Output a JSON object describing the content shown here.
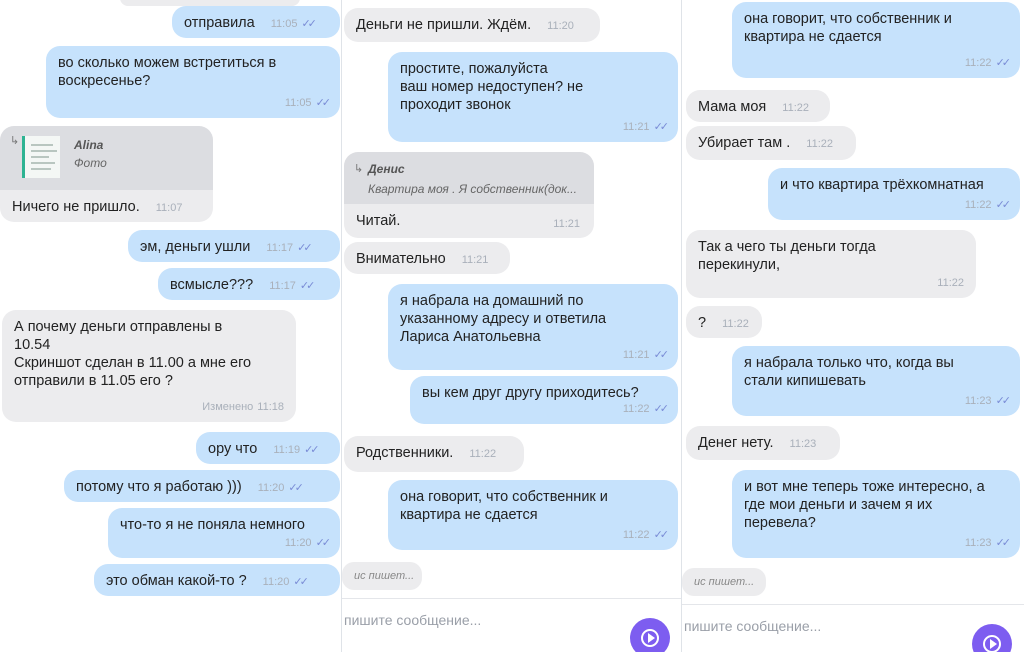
{
  "panel1": {
    "messages": [
      {
        "text": "отправила",
        "time": "11:05",
        "read": true
      },
      {
        "text": "во сколько можем встретиться в воскресенье?",
        "time": "11:05",
        "read": true
      },
      {
        "reply_name": "Alina",
        "reply_sub": "Фото",
        "text": "Ничего не пришло.",
        "time": "11:07"
      },
      {
        "text": "эм, деньги ушли",
        "time": "11:17",
        "read": true
      },
      {
        "text": "всмысле???",
        "time": "11:17",
        "read": true
      },
      {
        "text": "А почему деньги отправлены в\n10.54\nСкриншот сделан в 11.00 а мне его\nотправили в 11.05 его ?",
        "time": "11:18",
        "edited": "Изменено"
      },
      {
        "text": "ору что",
        "time": "11:19",
        "read": true
      },
      {
        "text": "потому что я работаю )))",
        "time": "11:20",
        "read": true
      },
      {
        "text": "что-то я не поняла немного",
        "time": "11:20",
        "read": true
      },
      {
        "text": "это обман какой-то ?",
        "time": "11:20",
        "read": true
      }
    ]
  },
  "panel2": {
    "messages": [
      {
        "text": "Деньги не пришли. Ждём.",
        "time": "11:20"
      },
      {
        "text": "простите, пожалуйста\nваш номер недоступен? не\nпроходит звонок",
        "time": "11:21",
        "read": true
      },
      {
        "reply_name": "Денис",
        "reply_sub": "Квартира моя . Я собственник(док...",
        "text": "Читай.",
        "time": "11:21"
      },
      {
        "text": "Внимательно",
        "time": "11:21"
      },
      {
        "text": "я набрала на домашний по\nуказанному адресу и ответила\nЛариса Анатольевна",
        "time": "11:21",
        "read": true
      },
      {
        "text": "вы кем друг другу приходитесь?",
        "time": "11:22",
        "read": true
      },
      {
        "text": "Родственники.",
        "time": "11:22"
      },
      {
        "text": "она говорит, что собственник и\nквартира не сдается",
        "time": "11:22",
        "read": true
      }
    ],
    "typing": "ис пишет...",
    "compose_placeholder": "пишите сообщение..."
  },
  "panel3": {
    "messages": [
      {
        "text": "она говорит, что собственник и\nквартира не сдается",
        "time": "11:22",
        "read": true
      },
      {
        "text": "Мама моя",
        "time": "11:22"
      },
      {
        "text": "Убирает там .",
        "time": "11:22"
      },
      {
        "text": "и что квартира трёхкомнатная",
        "time": "11:22",
        "read": true
      },
      {
        "text": "Так а чего ты деньги тогда\nперекинули,",
        "time": "11:22"
      },
      {
        "text": "?",
        "time": "11:22"
      },
      {
        "text": "я набрала только что, когда вы\nстали кипишевать",
        "time": "11:23",
        "read": true
      },
      {
        "text": "Денег нету.",
        "time": "11:23"
      },
      {
        "text": "и вот мне теперь тоже интересно, а\nгде мои деньги и зачем я их\nперевела?",
        "time": "11:23",
        "read": true
      }
    ],
    "typing": "ис пишет...",
    "compose_placeholder": "пишите сообщение..."
  },
  "colors": {
    "outgoing": "#c6e2fc",
    "incoming": "#ececee",
    "send_button": "#7d5df0",
    "read_check": "#7a8cd6"
  },
  "icons": {
    "read_receipt": "double-check-icon",
    "reply": "reply-arrow-icon",
    "send": "send-voice-icon"
  }
}
